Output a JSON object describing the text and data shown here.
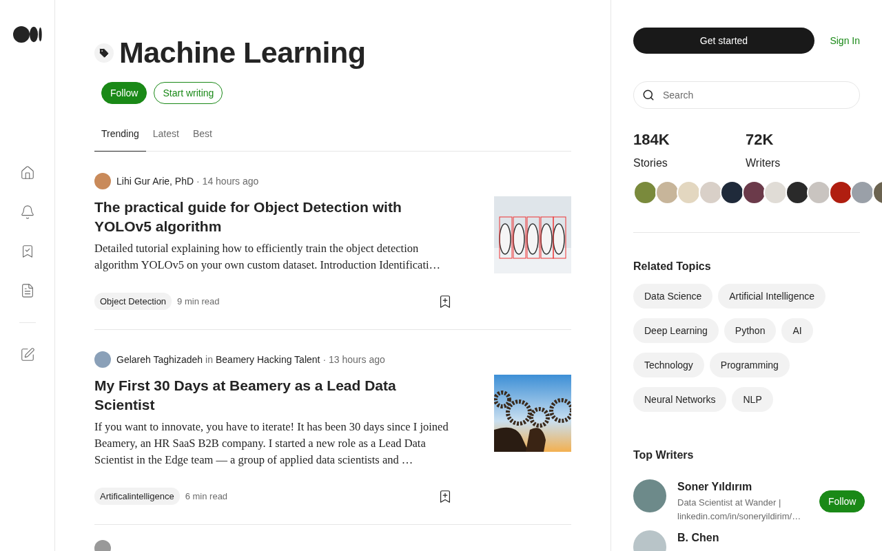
{
  "topic": {
    "title": "Machine Learning",
    "follow": "Follow",
    "start_writing": "Start writing"
  },
  "tabs": [
    {
      "label": "Trending",
      "selected": true
    },
    {
      "label": "Latest",
      "selected": false
    },
    {
      "label": "Best",
      "selected": false
    }
  ],
  "articles": [
    {
      "author": "Lihi Gur Arie, PhD",
      "time": "· 14 hours ago",
      "title": "The practical guide for Object Detection with YOLOv5 algorithm",
      "excerpt": "Detailed tutorial explaining how to efficiently train the object detection algorithm YOLOv5 on your own custom dataset. Introduction Identificati…",
      "tag": "Object Detection",
      "read_time": "9 min read"
    },
    {
      "author": "Gelareh Taghizadeh",
      "in": "in",
      "publication": "Beamery Hacking Talent",
      "time": "· 13 hours ago",
      "title": "My First 30 Days at Beamery as a Lead Data Scientist",
      "excerpt": "If you want to innovate, you have to iterate! It has been 30 days since I joined Beamery, an HR SaaS B2B company. I started a new role as a Lead Data Scientist in the Edge team — a group of applied data scientists and …",
      "tag": "Artificalintelligence",
      "read_time": "6 min read"
    }
  ],
  "header": {
    "get_started": "Get started",
    "sign_in": "Sign In"
  },
  "search": {
    "placeholder": "Search"
  },
  "stats": [
    {
      "value": "184K",
      "label": "Stories"
    },
    {
      "value": "72K",
      "label": "Writers"
    }
  ],
  "related_topics": {
    "heading": "Related Topics",
    "items": [
      "Data Science",
      "Artificial Intelligence",
      "Deep Learning",
      "Python",
      "AI",
      "Technology",
      "Programming",
      "Neural Networks",
      "NLP"
    ]
  },
  "top_writers": {
    "heading": "Top Writers",
    "items": [
      {
        "name": "Soner Yıldırım",
        "bio": "Data Scientist at Wander | linkedin.com/in/soneryildirim/…",
        "follow": "Follow"
      },
      {
        "name": "B. Chen"
      }
    ]
  }
}
